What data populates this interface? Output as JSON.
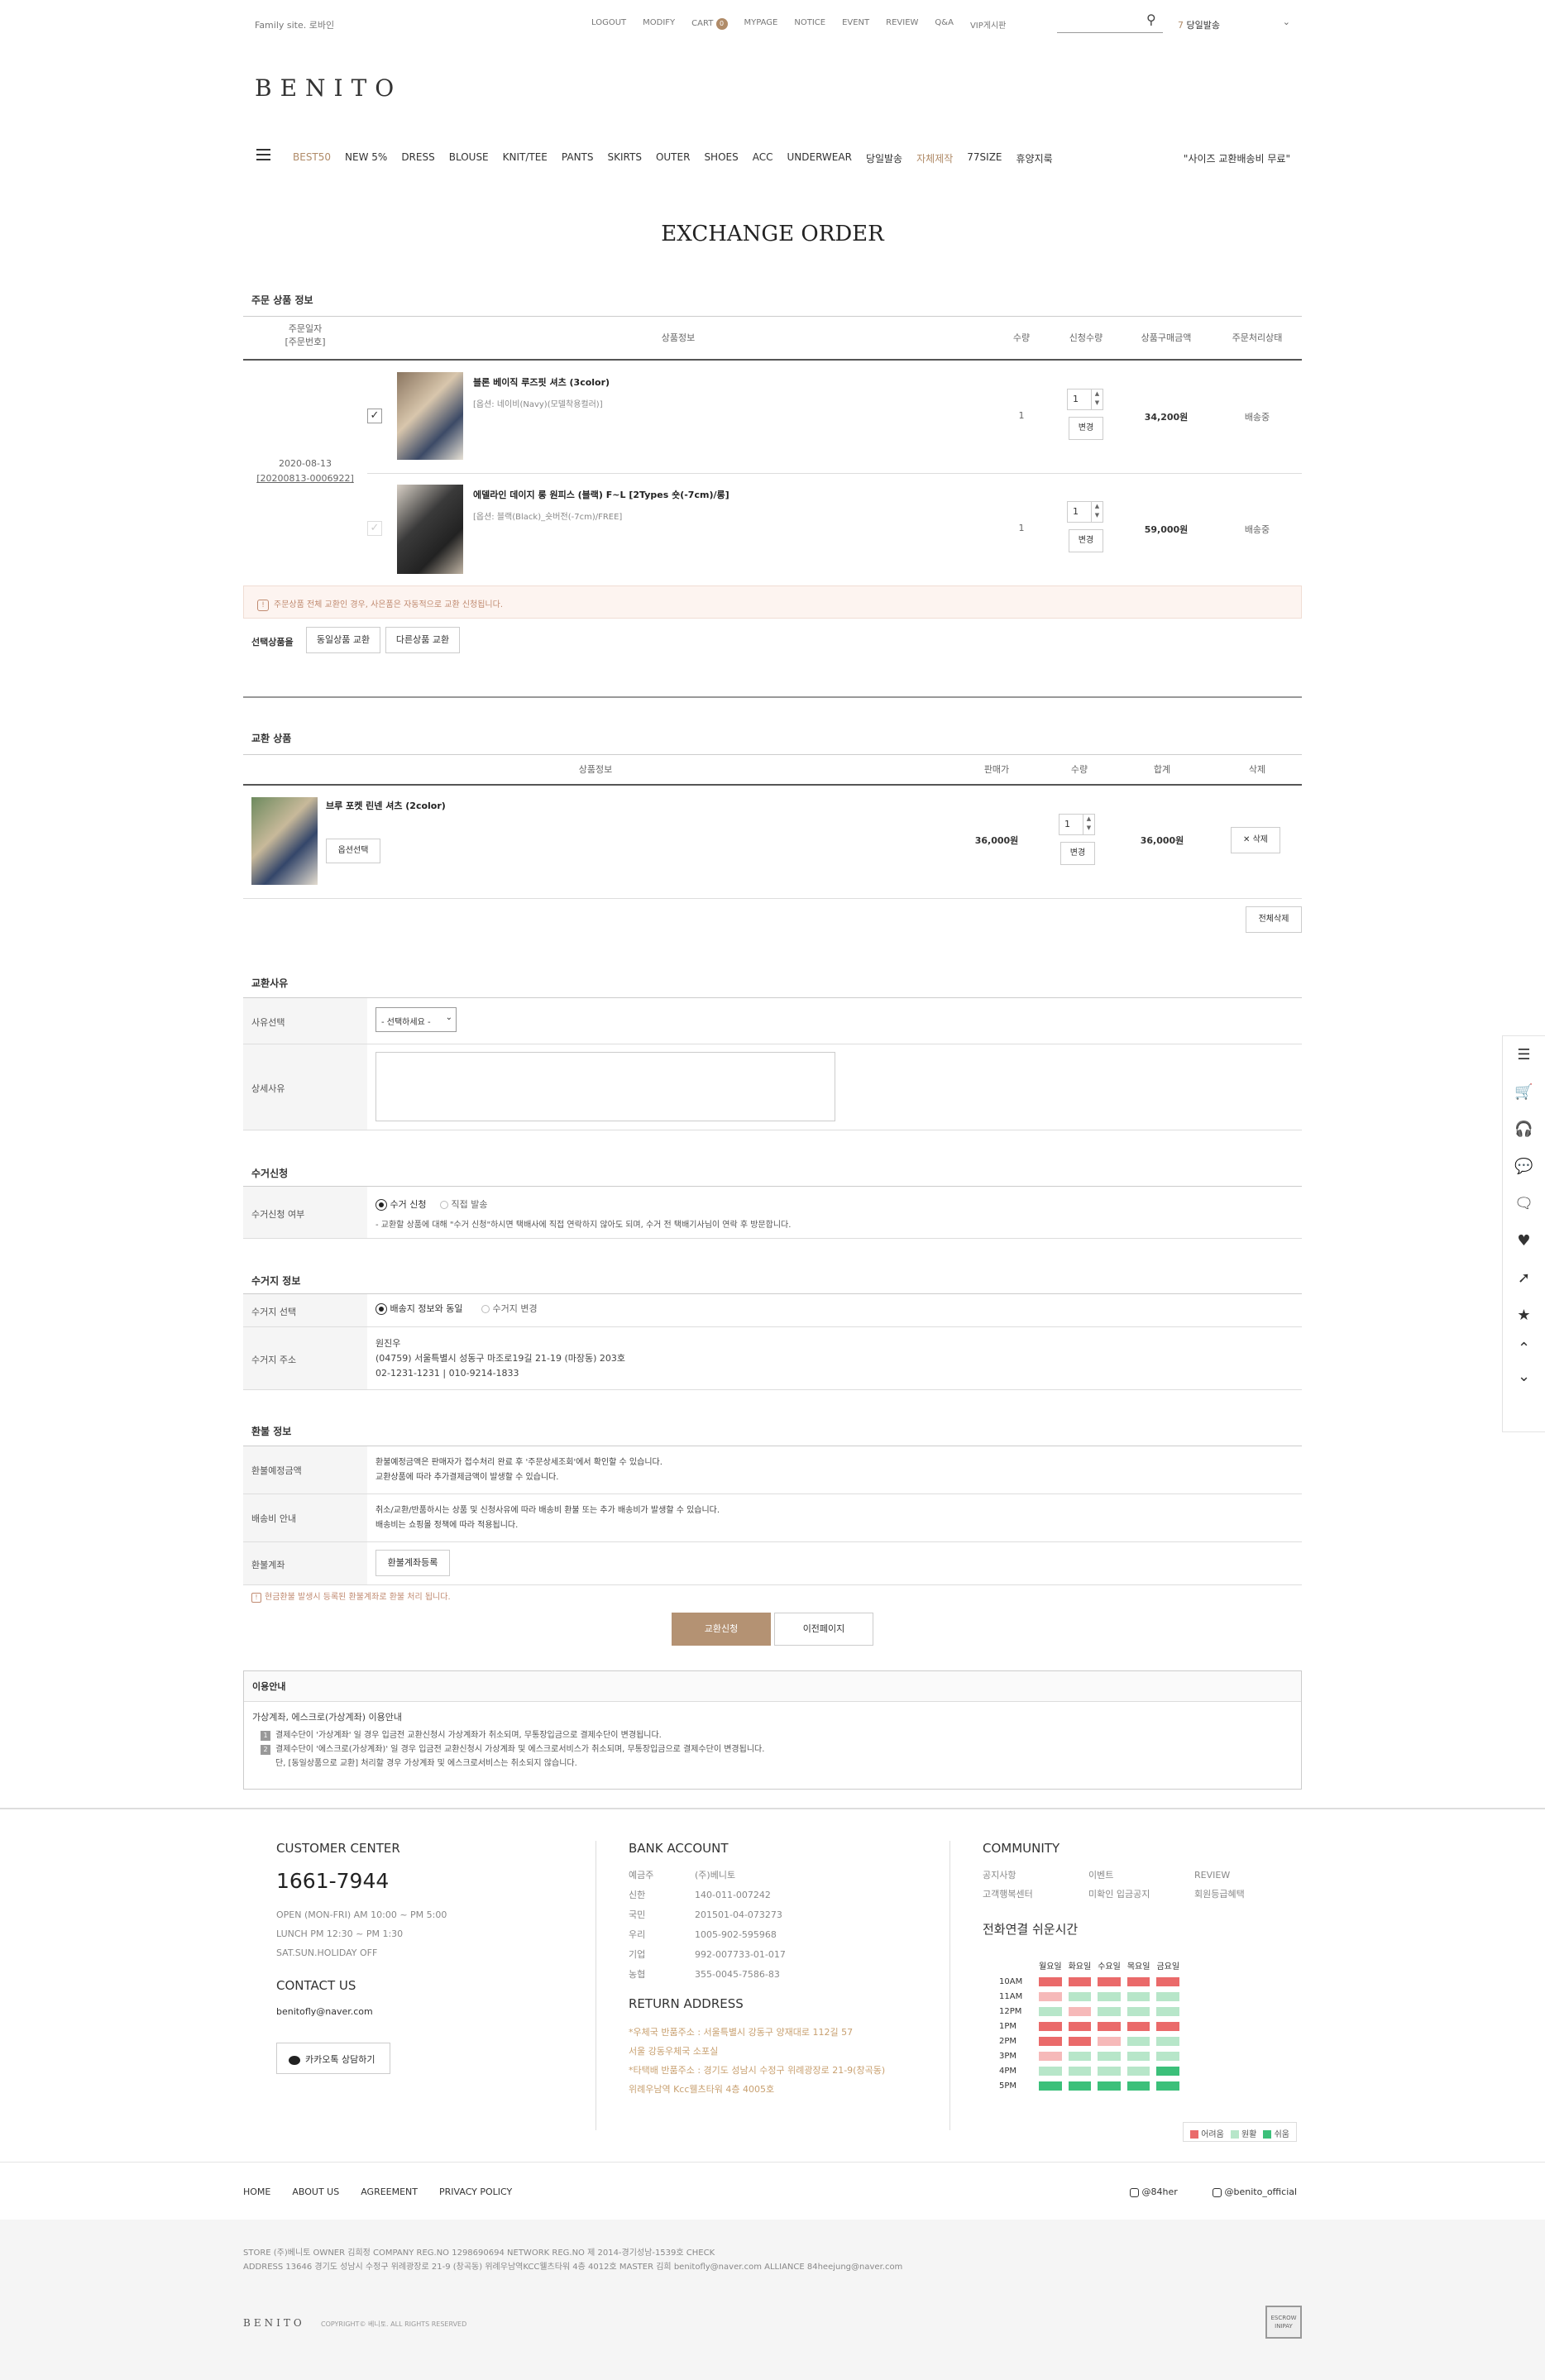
{
  "topbar": {
    "family_site": "Family site. 로바인",
    "links": [
      "LOGOUT",
      "MODIFY",
      "CART",
      "MYPAGE",
      "NOTICE",
      "EVENT",
      "REVIEW",
      "Q&A",
      "VIP게시판"
    ],
    "cart_count": "0",
    "same_day": "당일발송",
    "same_day_prefix": "7"
  },
  "logo": "BENITO",
  "nav": {
    "items": [
      "BEST50",
      "NEW 5%",
      "DRESS",
      "BLOUSE",
      "KNIT/TEE",
      "PANTS",
      "SKIRTS",
      "OUTER",
      "SHOES",
      "ACC",
      "UNDERWEAR",
      "당일발송",
      "자체제작",
      "77SIZE",
      "휴양지룩"
    ],
    "promo": "\"사이즈 교환배송비 무료\""
  },
  "page_title": "EXCHANGE ORDER",
  "order_section": {
    "title": "주문 상품 정보",
    "headers": {
      "date": "주문일자",
      "date_sub": "[주문번호]",
      "info": "상품정보",
      "qty": "수량",
      "req_qty": "신청수량",
      "price": "상품구매금액",
      "status": "주문처리상태"
    },
    "order_date": "2020-08-13",
    "order_no": "[20200813-0006922]",
    "items": [
      {
        "name": "블론 베이직 루즈핏 셔츠 (3color)",
        "option": "[옵션: 네이비(Navy)(모델착용컬러)]",
        "qty": "1",
        "req_qty": "1",
        "change": "변경",
        "price": "34,200원",
        "status": "배송중"
      },
      {
        "name": "에델라인 데이지 롱 원피스 (블랙) F~L [2Types 숏(-7cm)/롱]",
        "option": "[옵션: 블랙(Black)_숏버전(-7cm)/FREE]",
        "qty": "1",
        "req_qty": "1",
        "change": "변경",
        "price": "59,000원",
        "status": "배송중"
      }
    ],
    "notice": "주문상품 전체 교환인 경우, 사은품은 자동적으로 교환 신청됩니다.",
    "selected_label": "선택상품을",
    "btn_same": "동일상품 교환",
    "btn_other": "다른상품 교환"
  },
  "exchange_section": {
    "title": "교환 상품",
    "headers": {
      "info": "상품정보",
      "price": "판매가",
      "qty": "수량",
      "total": "합계",
      "delete": "삭제"
    },
    "item": {
      "name": "브루 포켓 린넨 셔츠 (2color)",
      "option_btn": "옵션선택",
      "price": "36,000원",
      "qty": "1",
      "change": "변경",
      "total": "36,000원",
      "delete": "✕ 삭제"
    },
    "delete_all": "전체삭제"
  },
  "reason_section": {
    "title": "교환사유",
    "select_label": "사유선택",
    "select_value": "- 선택하세요 -",
    "detail_label": "상세사유"
  },
  "pickup_section": {
    "title": "수거신청",
    "label": "수거신청 여부",
    "opt1": "수거 신청",
    "opt2": "직접 발송",
    "note": "- 교환할 상품에 대해 \"수거 신청\"하시면 택배사에 직접 연락하지 않아도 되며, 수거 전 택배기사님이 연락 후 방문합니다."
  },
  "pickup_info": {
    "title": "수거지 정보",
    "select_label": "수거지 선택",
    "opt1": "배송지 정보와 동일",
    "opt2": "수거지 변경",
    "addr_label": "수거지 주소",
    "name": "원진우",
    "address": "(04759) 서울특별시 성동구 마조로19길 21-19 (마장동) 203호",
    "phone": "02-1231-1231 | 010-9214-1833"
  },
  "refund_section": {
    "title": "환불 정보",
    "r1_label": "환불예정금액",
    "r1_l1": "환불예정금액은 판매자가 접수처리 완료 후 '주문상세조회'에서 확인할 수 있습니다.",
    "r1_l2": "교환상품에 따라 추가결제금액이 발생할 수 있습니다.",
    "r2_label": "배송비 안내",
    "r2_l1": "취소/교환/반품하시는 상품 및 신청사유에 따라 배송비 환불 또는 추가 배송비가 발생할 수 있습니다.",
    "r2_l2": "배송비는 쇼핑몰 정책에 따라 적용됩니다.",
    "r3_label": "환불계좌",
    "r3_btn": "환불계좌등록",
    "warn": "현금환불 발생시 등록된 환불계좌로 환불 처리 됩니다."
  },
  "actions": {
    "submit": "교환신청",
    "prev": "이전페이지"
  },
  "guide": {
    "title": "이용안내",
    "sub": "가상계좌, 에스크로(가상계좌) 이용안내",
    "l1": "결제수단이 '가상계좌' 일 경우 입금전 교환신청시 가상계좌가 취소되며, 무통장입금으로 결제수단이 변경됩니다.",
    "l2": "결제수단이 '에스크로(가상계좌)' 일 경우 입금전 교환신청시 가상계좌 및 에스크로서비스가 취소되며, 무통장입금으로 결제수단이 변경됩니다.",
    "l3": "단, [동일상품으로 교환] 처리할 경우 가상계좌 및 에스크로서비스는 취소되지 않습니다."
  },
  "footer": {
    "cc_title": "CUSTOMER CENTER",
    "phone": "1661-7944",
    "open": "OPEN (MON-FRI) AM 10:00 ~ PM 5:00",
    "lunch": "LUNCH PM 12:30 ~ PM 1:30",
    "holiday": "SAT.SUN.HOLIDAY OFF",
    "contact_title": "CONTACT US",
    "email": "benitofly@naver.com",
    "kakao": "카카오톡 상담하기",
    "bank_title": "BANK ACCOUNT",
    "banks": [
      [
        "예금주",
        "(주)베니토"
      ],
      [
        "신한",
        "140-011-007242"
      ],
      [
        "국민",
        "201501-04-073273"
      ],
      [
        "우리",
        "1005-902-595968"
      ],
      [
        "기업",
        "992-007733-01-017"
      ],
      [
        "농협",
        "355-0045-7586-83"
      ]
    ],
    "return_title": "RETURN ADDRESS",
    "ret": [
      "*우체국 반품주소 : 서울특별시 강동구 양재대로 112길 57",
      "서울 강동우체국 소포실",
      "*타택배 반품주소 : 경기도 성남시 수정구 위례광장로 21-9(창곡동)",
      "위례우남역 Kcc웰츠타워 4층 4005호"
    ],
    "community_title": "COMMUNITY",
    "community": [
      "공지사항",
      "이벤트",
      "REVIEW",
      "고객행복센터",
      "미확인 입금공지",
      "회원등급혜택"
    ],
    "call_title": "전화연결 쉬운시간",
    "days": [
      "월요일",
      "화요일",
      "수요일",
      "목요일",
      "금요일"
    ],
    "hours": [
      "10AM",
      "11AM",
      "12PM",
      "1PM",
      "2PM",
      "3PM",
      "4PM",
      "5PM"
    ],
    "grid": [
      "rrrrr",
      "pgggg",
      "gpggg",
      "rrrrr",
      "rrpgg",
      "pgggg",
      "ggggG",
      "GGGGG"
    ],
    "legend": [
      "어려움",
      "원활",
      "쉬움"
    ],
    "links": [
      "HOME",
      "ABOUT US",
      "AGREEMENT",
      "PRIVACY POLICY"
    ],
    "insta1": "@84her",
    "insta2": "@benito_official",
    "biz1": "STORE (주)베니토    OWNER  김희정    COMPANY REG.NO  1298690694    NETWORK REG.NO  제 2014-경기성남-1539호  CHECK",
    "biz2": "ADDRESS  13646 경기도 성남시 수정구 위례광장로 21-9 (창곡동) 위례우남역KCC웰츠타워 4층 4012호    MASTER  김희   benitofly@naver.com    ALLIANCE  84heejung@naver.com",
    "logo": "BENITO",
    "copyright": "COPYRIGHT© 베니토. ALL RIGHTS RESERVED",
    "badge": "ESCROW INIPAY"
  },
  "colors": {
    "accent": "#b08b68",
    "submit": "#b49273",
    "warning_bg": "#fdf4f0"
  }
}
